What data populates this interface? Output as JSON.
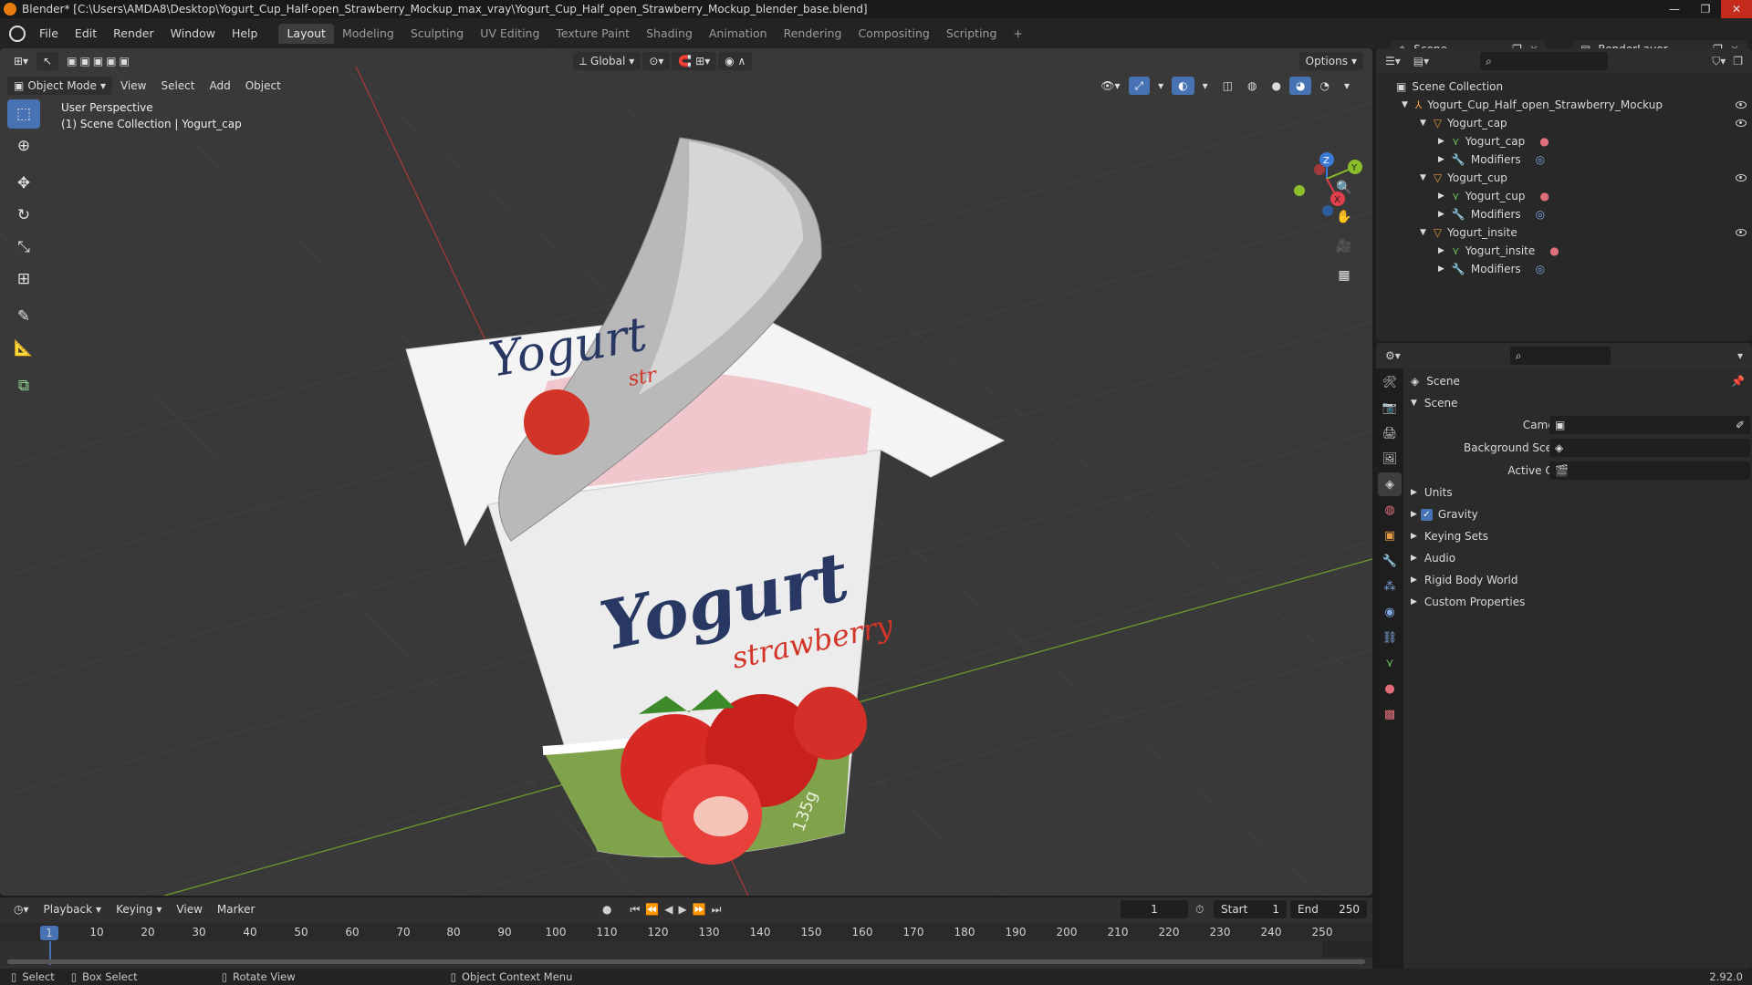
{
  "window": {
    "title": "Blender* [C:\\Users\\AMDA8\\Desktop\\Yogurt_Cup_Half-open_Strawberry_Mockup_max_vray\\Yogurt_Cup_Half_open_Strawberry_Mockup_blender_base.blend]",
    "minimize": "—",
    "maximize": "❐",
    "close": "✕"
  },
  "menu": {
    "items": [
      "File",
      "Edit",
      "Render",
      "Window",
      "Help"
    ],
    "workspaces": [
      "Layout",
      "Modeling",
      "Sculpting",
      "UV Editing",
      "Texture Paint",
      "Shading",
      "Animation",
      "Rendering",
      "Compositing",
      "Scripting"
    ],
    "add_workspace": "+",
    "scene_name": "Scene",
    "view_layer": "RenderLayer"
  },
  "viewport": {
    "transform_orientation": "Global",
    "options_label": "Options",
    "mode": "Object Mode",
    "header_menus": [
      "View",
      "Select",
      "Add",
      "Object"
    ],
    "perspective": "User Perspective",
    "collection_info": "(1) Scene Collection | Yogurt_cap",
    "gizmo_axes": {
      "x": "X",
      "y": "Y",
      "z": "Z"
    },
    "cup_label": {
      "brand_lid": "Yogurt",
      "lid_flavor": "str",
      "brand_cup": "Yogurt",
      "flavor_cup": "strawberry",
      "weight": "135g"
    },
    "colors": {
      "background": "#393939",
      "grid": "#424242",
      "x_axis": "#a23a3a",
      "y_axis": "#6b9a2a"
    }
  },
  "outliner": {
    "root": "Scene Collection",
    "rows": [
      {
        "label": "Yogurt_Cup_Half_open_Strawberry_Mockup",
        "icon": "empty-icon",
        "depth": 1
      },
      {
        "label": "Yogurt_cap",
        "icon": "object-icon",
        "depth": 2
      },
      {
        "label": "Yogurt_cap",
        "icon": "mesh-icon",
        "depth": 3
      },
      {
        "label": "Modifiers",
        "icon": "wrench-icon",
        "depth": 3
      },
      {
        "label": "Yogurt_cup",
        "icon": "object-icon",
        "depth": 2
      },
      {
        "label": "Yogurt_cup",
        "icon": "mesh-icon",
        "depth": 3
      },
      {
        "label": "Modifiers",
        "icon": "wrench-icon",
        "depth": 3
      },
      {
        "label": "Yogurt_insite",
        "icon": "object-icon",
        "depth": 2
      },
      {
        "label": "Yogurt_insite",
        "icon": "mesh-icon",
        "depth": 3
      },
      {
        "label": "Modifiers",
        "icon": "wrench-icon",
        "depth": 3
      }
    ]
  },
  "properties": {
    "context": "Scene",
    "panel_title": "Scene",
    "fields": {
      "camera_label": "Camera",
      "background_scene_label": "Background Scene",
      "active_clip_label": "Active Clip"
    },
    "panels": [
      "Units",
      "Gravity",
      "Keying Sets",
      "Audio",
      "Rigid Body World",
      "Custom Properties"
    ],
    "gravity_checked": true
  },
  "timeline": {
    "menus": [
      "Playback",
      "Keying",
      "View",
      "Marker"
    ],
    "current_frame": "1",
    "start_label": "Start",
    "start": "1",
    "end_label": "End",
    "end": "250",
    "ruler": [
      "10",
      "20",
      "30",
      "40",
      "50",
      "60",
      "70",
      "80",
      "90",
      "100",
      "110",
      "120",
      "130",
      "140",
      "150",
      "160",
      "170",
      "180",
      "190",
      "200",
      "210",
      "220",
      "230",
      "240",
      "250"
    ],
    "playhead_label": "1"
  },
  "status": {
    "select": "Select",
    "box_select": "Box Select",
    "rotate_view": "Rotate View",
    "context_menu": "Object Context Menu",
    "version": "2.92.0"
  }
}
